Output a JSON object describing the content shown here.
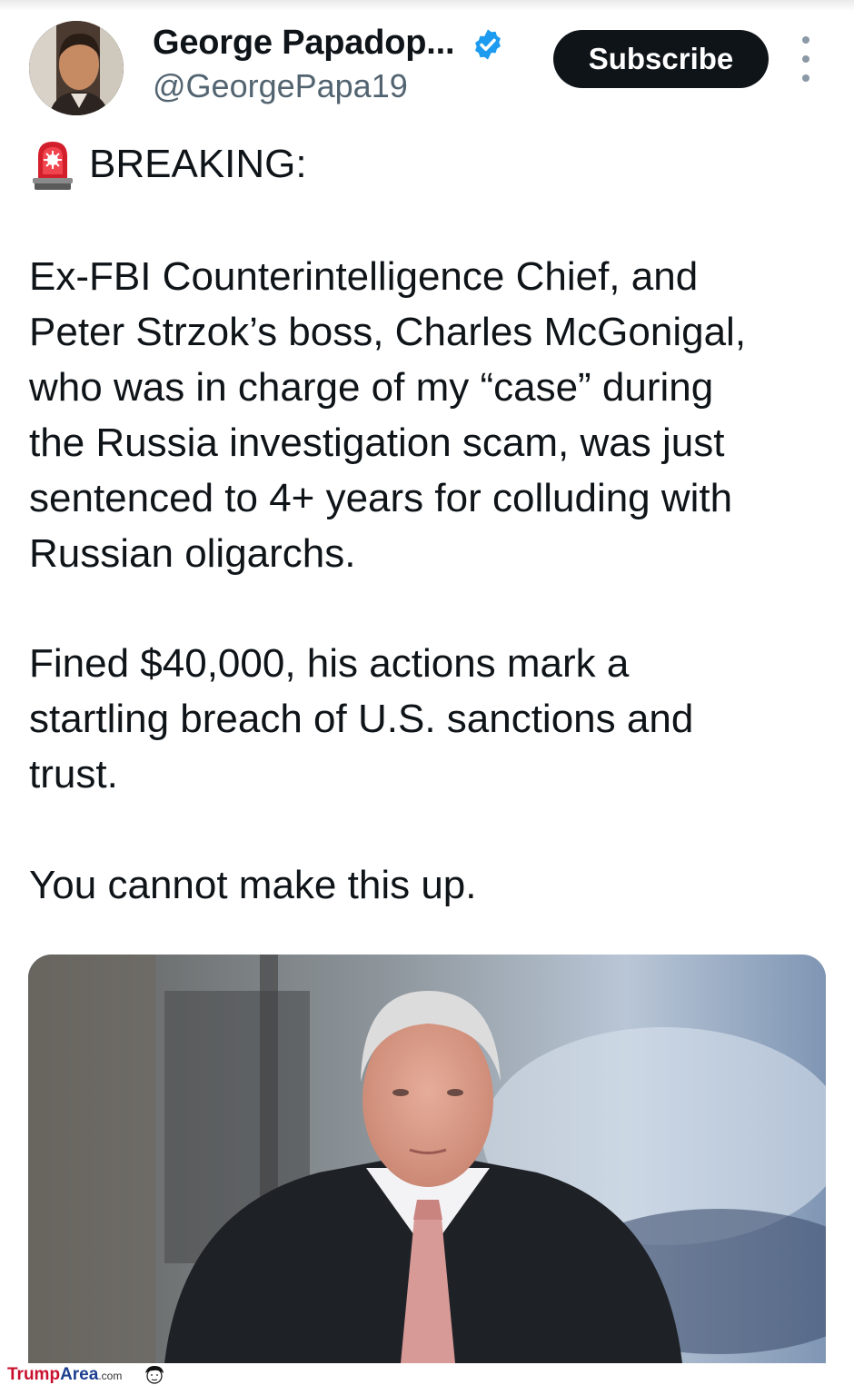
{
  "header": {
    "display_name": "George Papadop...",
    "handle": "@GeorgePapa19",
    "subscribe_label": "Subscribe",
    "verified_color": "#1d9bf0"
  },
  "icons": {
    "verified": "verified-badge-icon",
    "more": "more-options-icon",
    "siren": "police-siren-emoji"
  },
  "tweet": {
    "breaking": "BREAKING:",
    "paragraph1": "Ex-FBI Counterintelligence Chief, and\nPeter Strzok’s boss, Charles McGonigal,\nwho was in charge of my “case” during\nthe Russia investigation scam, was just\nsentenced to 4+ years for colluding with\nRussian oligarchs.",
    "paragraph2": "Fined $40,000, his actions mark a\nstartling breach of U.S. sanctions and\ntrust.",
    "paragraph3": "You cannot make this up."
  },
  "watermark": {
    "trump": "Trump",
    "area": "Area",
    "dotcom": ".com"
  },
  "colors": {
    "text": "#0f1419",
    "secondary": "#536471",
    "button_bg": "#0f1419",
    "button_text": "#ffffff"
  }
}
